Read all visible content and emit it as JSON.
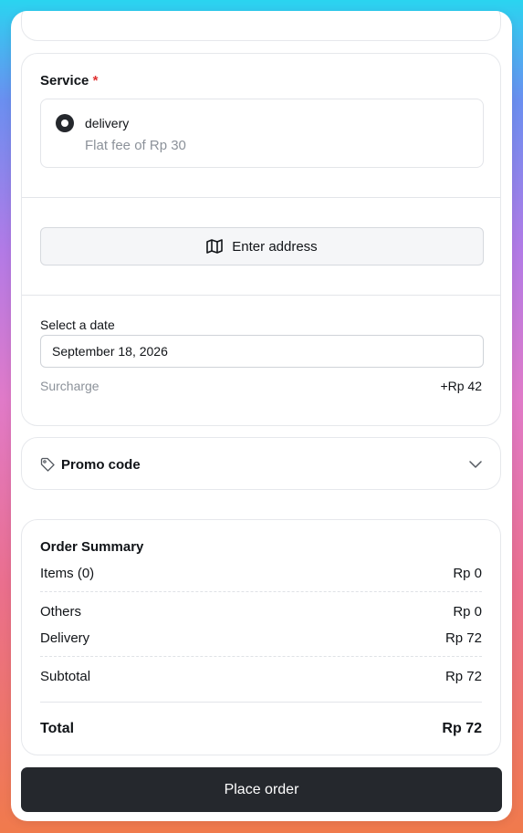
{
  "service": {
    "label": "Service",
    "required_mark": "*",
    "option": {
      "name": "delivery",
      "description": "Flat fee of Rp 30",
      "selected": true
    },
    "enter_address": "Enter address"
  },
  "date": {
    "label": "Select a date",
    "value": "September 18, 2026",
    "surcharge_label": "Surcharge",
    "surcharge_value": "+Rp 42"
  },
  "promo": {
    "label": "Promo code"
  },
  "summary": {
    "title": "Order Summary",
    "items_label": "Items (0)",
    "items_value": "Rp 0",
    "others_label": "Others",
    "others_value": "Rp 0",
    "delivery_label": "Delivery",
    "delivery_value": "Rp 72",
    "subtotal_label": "Subtotal",
    "subtotal_value": "Rp 72",
    "total_label": "Total",
    "total_value": "Rp 72"
  },
  "place_order": "Place order",
  "colors": {
    "dark": "#25282d",
    "required": "#e03131",
    "muted": "#8c929a"
  }
}
